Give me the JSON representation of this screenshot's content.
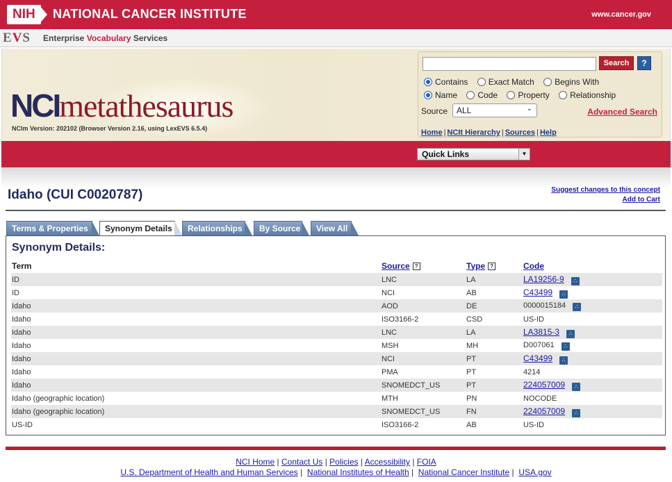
{
  "banner": {
    "nih": "NIH",
    "title": "NATIONAL CANCER INSTITUTE",
    "url": "www.cancer.gov"
  },
  "evs": {
    "logo_e": "E",
    "logo_v": "V",
    "logo_s": "S",
    "text_1": "Enterprise ",
    "text_2": "Vocabulary",
    "text_3": " Services"
  },
  "app": {
    "logo_nci": "NCI",
    "logo_rest": "metathesaurus",
    "version": "NCIm Version: 202102 (Browser Version 2.16, using LexEVS 6.5.4)"
  },
  "search": {
    "input_value": "",
    "button_label": "Search",
    "help_label": "?",
    "match_options": [
      {
        "label": "Contains",
        "selected": true
      },
      {
        "label": "Exact Match",
        "selected": false
      },
      {
        "label": "Begins With",
        "selected": false
      }
    ],
    "target_options": [
      {
        "label": "Name",
        "selected": true
      },
      {
        "label": "Code",
        "selected": false
      },
      {
        "label": "Property",
        "selected": false
      },
      {
        "label": "Relationship",
        "selected": false
      }
    ],
    "source_label": "Source",
    "source_value": "ALL",
    "advanced_label": "Advanced Search"
  },
  "nav": {
    "home": "Home",
    "hierarchy": "NCIt Hierarchy",
    "sources": "Sources",
    "help": "Help",
    "sep": "|"
  },
  "quick_links": "Quick Links",
  "concept": {
    "title": "Idaho (CUI C0020787)",
    "suggest": "Suggest changes to this concept",
    "cart": "Add to Cart"
  },
  "tabs": [
    {
      "label": "Terms & Properties",
      "active": false
    },
    {
      "label": "Synonym Details",
      "active": true
    },
    {
      "label": "Relationships",
      "active": false
    },
    {
      "label": "By Source",
      "active": false
    },
    {
      "label": "View All",
      "active": false
    }
  ],
  "synonyms": {
    "heading": "Synonym Details:",
    "headers": {
      "term": "Term",
      "source": "Source",
      "type": "Type",
      "code": "Code",
      "help_glyph": "?"
    },
    "rows": [
      {
        "term": "ID",
        "source": "LNC",
        "type": "LA",
        "code": "LA19256-9",
        "code_link": true,
        "tree": true
      },
      {
        "term": "ID",
        "source": "NCI",
        "type": "AB",
        "code": "C43499",
        "code_link": true,
        "tree": true
      },
      {
        "term": "Idaho",
        "source": "AOD",
        "type": "DE",
        "code": "0000015184",
        "code_link": false,
        "tree": true
      },
      {
        "term": "Idaho",
        "source": "ISO3166-2",
        "type": "CSD",
        "code": "US-ID",
        "code_link": false,
        "tree": false
      },
      {
        "term": "Idaho",
        "source": "LNC",
        "type": "LA",
        "code": "LA3815-3",
        "code_link": true,
        "tree": true
      },
      {
        "term": "Idaho",
        "source": "MSH",
        "type": "MH",
        "code": "D007061",
        "code_link": false,
        "tree": true
      },
      {
        "term": "Idaho",
        "source": "NCI",
        "type": "PT",
        "code": "C43499",
        "code_link": true,
        "tree": true
      },
      {
        "term": "Idaho",
        "source": "PMA",
        "type": "PT",
        "code": "4214",
        "code_link": false,
        "tree": false
      },
      {
        "term": "Idaho",
        "source": "SNOMEDCT_US",
        "type": "PT",
        "code": "224057009",
        "code_link": true,
        "tree": true
      },
      {
        "term": "Idaho (geographic location)",
        "source": "MTH",
        "type": "PN",
        "code": "NOCODE",
        "code_link": false,
        "tree": false
      },
      {
        "term": "Idaho (geographic location)",
        "source": "SNOMEDCT_US",
        "type": "FN",
        "code": "224057009",
        "code_link": true,
        "tree": true
      },
      {
        "term": "US-ID",
        "source": "ISO3166-2",
        "type": "AB",
        "code": "US-ID",
        "code_link": false,
        "tree": false
      }
    ]
  },
  "footer": {
    "line1": [
      "NCI Home",
      "Contact Us",
      "Policies",
      "Accessibility",
      "FOIA"
    ],
    "line2": [
      "U.S. Department of Health and Human Services",
      "National Institutes of Health",
      "National Cancer Institute",
      "USA.gov"
    ]
  },
  "colors": {
    "brand_red": "#c4203e",
    "link_blue": "#1a1aa6",
    "title_navy": "#1f2a5e",
    "tab_blue": "#5d7ca6"
  },
  "icons": {
    "tree": "tree-icon",
    "help": "help-icon"
  }
}
